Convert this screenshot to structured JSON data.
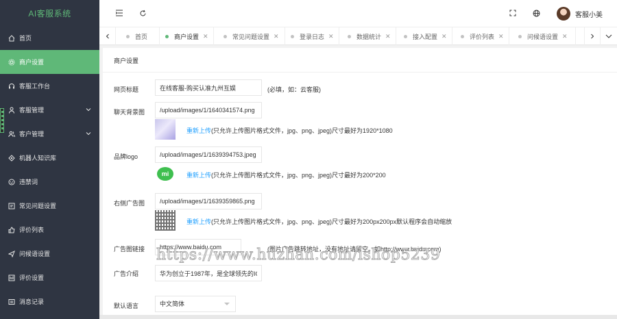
{
  "app": {
    "title": "AI客服系统"
  },
  "sidebar": {
    "items": [
      {
        "label": "首页",
        "icon": "home-icon"
      },
      {
        "label": "商户设置",
        "icon": "gear-icon",
        "active": true
      },
      {
        "label": "客服工作台",
        "icon": "headset-icon"
      },
      {
        "label": "客服管理",
        "icon": "user-icon",
        "has_submenu": true
      },
      {
        "label": "客户管理",
        "icon": "users-icon",
        "has_submenu": true
      },
      {
        "label": "机器人知识库",
        "icon": "robot-icon"
      },
      {
        "label": "违禁词",
        "icon": "ban-icon"
      },
      {
        "label": "常见问题设置",
        "icon": "faq-icon"
      },
      {
        "label": "评价列表",
        "icon": "thumb-icon"
      },
      {
        "label": "问候语设置",
        "icon": "send-icon"
      },
      {
        "label": "评价设置",
        "icon": "rating-icon"
      },
      {
        "label": "消息记录",
        "icon": "message-icon"
      }
    ]
  },
  "header": {
    "user_name": "客服小美",
    "icons": [
      "menu-fold-icon",
      "refresh-icon",
      "fullscreen-icon",
      "globe-icon"
    ]
  },
  "tabs": {
    "items": [
      {
        "label": "首页",
        "closable": false
      },
      {
        "label": "商户设置",
        "closable": true,
        "active": true
      },
      {
        "label": "常见问题设置",
        "closable": true
      },
      {
        "label": "登录日志",
        "closable": true
      },
      {
        "label": "数据统计",
        "closable": true
      },
      {
        "label": "接入配置",
        "closable": true
      },
      {
        "label": "评价列表",
        "closable": true
      },
      {
        "label": "问候语设置",
        "closable": true
      }
    ],
    "close_glyph": "✕"
  },
  "form": {
    "card_title": "商户设置",
    "title_label": "网页标题",
    "title_value": "在线客服-购买认准九州互娱",
    "title_hint": "(必填，如：云客服)",
    "bg_label": "聊天背景图",
    "bg_value": "/upload/images/1/1640341574.png",
    "bg_reupload": "重新上传",
    "bg_hint": "(只允许上传图片格式文件，jpg、png、jpeg)尺寸最好为1920*1080",
    "logo_label": "品牌logo",
    "logo_value": "/upload/images/1/1639394753.jpeg",
    "logo_reupload": "重新上传",
    "logo_hint": "(只允许上传图片格式文件，jpg、png、jpeg)尺寸最好为200*200",
    "logo_thumb_text": "mi",
    "ad_img_label": "右侧广告图",
    "ad_img_value": "/upload/images/1/1639359865.png",
    "ad_img_reupload": "重新上传",
    "ad_img_hint": "(只允许上传图片格式文件，jpg、png、jpeg)尺寸最好为200px200px默认程序会自动缩放",
    "ad_link_label": "广告图链接",
    "ad_link_value": "https://www.baidu.com",
    "ad_link_hint": "(图片广告跳转地址，没有地址请留空。如http://www.baidu.com)",
    "ad_intro_label": "广告介绍",
    "ad_intro_value": "华为创立于1987年，是全球领先的ICT",
    "lang_label": "默认语言",
    "lang_value": "中文简体"
  },
  "watermark": {
    "text": "https://www.huzhan.com/ishop5239"
  },
  "colors": {
    "accent": "#5fb878",
    "sidebar_bg": "#2f3542",
    "link": "#1e9fff"
  }
}
